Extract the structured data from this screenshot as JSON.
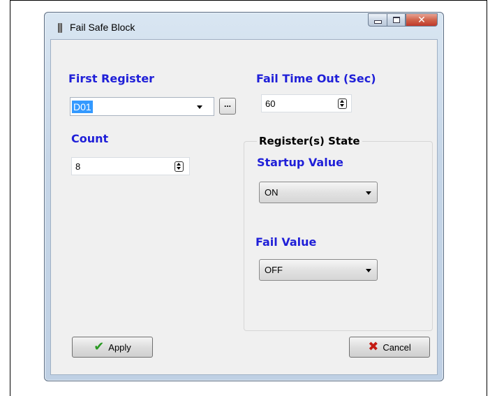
{
  "window": {
    "title": "Fail Safe Block",
    "close_glyph": "✕"
  },
  "first_register": {
    "label": "First Register",
    "value": "D01",
    "browse_label": "..."
  },
  "count": {
    "label": "Count",
    "value": "8"
  },
  "fail_timeout": {
    "label": "Fail Time Out (Sec)",
    "value": "60"
  },
  "register_state": {
    "title": "Register(s) State",
    "startup_label": "Startup Value",
    "startup_value": "ON",
    "fail_label": "Fail Value",
    "fail_value": "OFF"
  },
  "buttons": {
    "apply_label": "Apply",
    "apply_icon": "✔",
    "cancel_label": "Cancel",
    "cancel_icon": "✖"
  },
  "colors": {
    "label_blue": "#1f1fd8",
    "selection": "#3399ff",
    "apply_check": "#2a9a23",
    "cancel_x": "#c41a12"
  }
}
